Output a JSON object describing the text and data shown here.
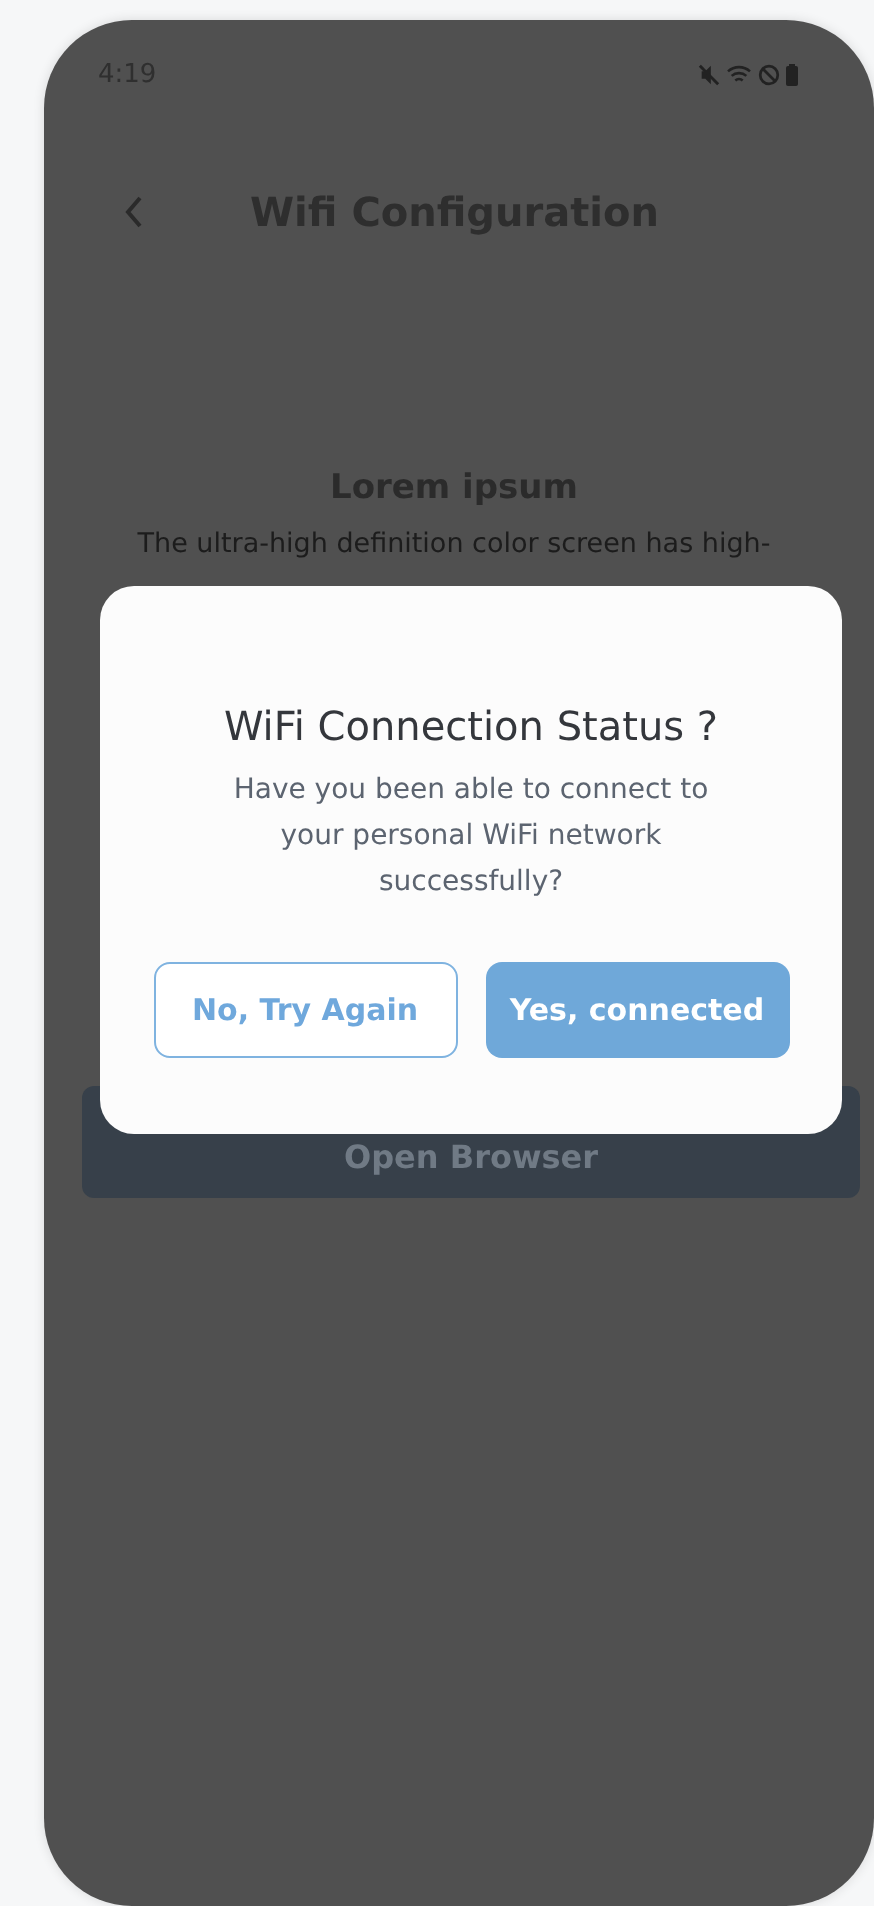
{
  "status_bar": {
    "time": "4:19"
  },
  "header": {
    "title": "Wifi Configuration"
  },
  "content": {
    "heading": "Lorem ipsum",
    "description": "The ultra-high definition color screen has high-",
    "button": "Open Browser"
  },
  "dialog": {
    "title": "WiFi Connection Status ?",
    "message": "Have you been able to connect to your personal WiFi network successfully?",
    "buttons": [
      {
        "label": "No, Try Again",
        "kind": "outline"
      },
      {
        "label": "Yes, connected",
        "kind": "filled"
      }
    ]
  }
}
